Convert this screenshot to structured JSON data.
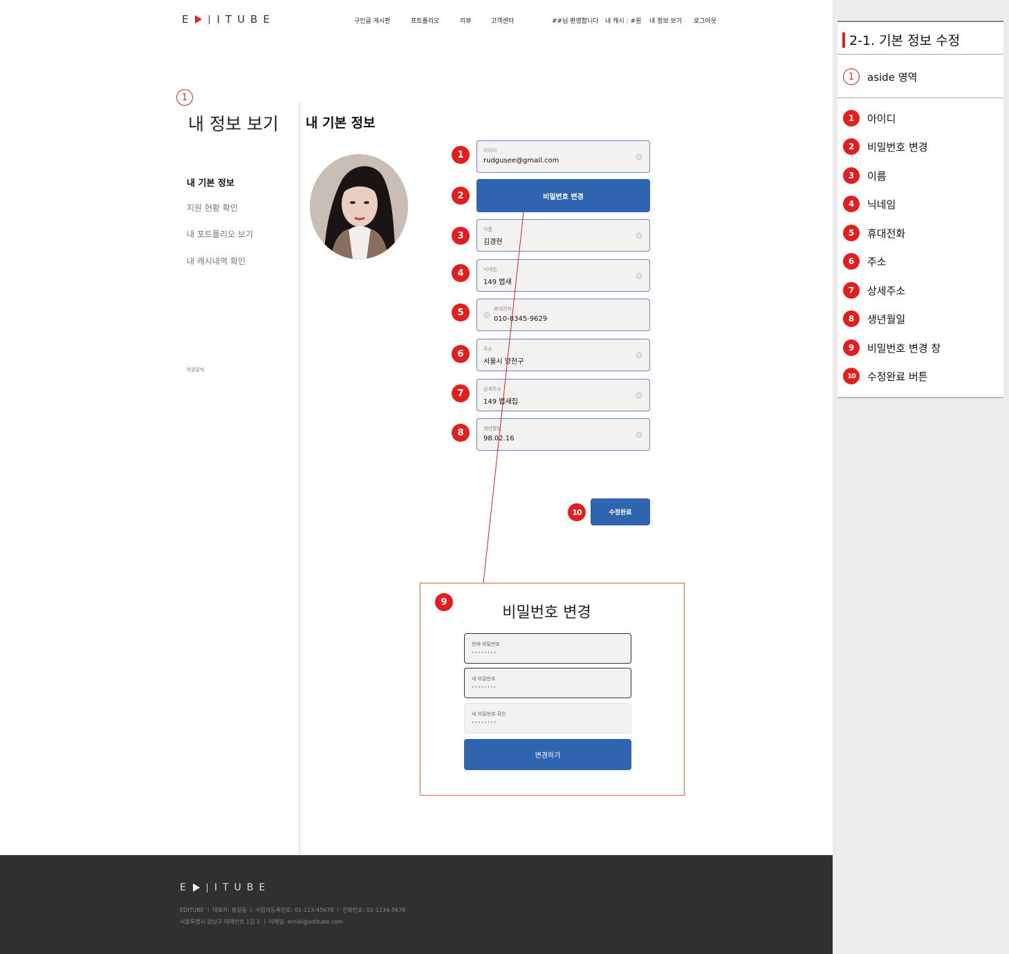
{
  "header": {
    "logo": "ITUBE",
    "logo_prefix": "E",
    "nav": [
      "구인글 게시판",
      "포트폴리오",
      "리뷰",
      "고객센터"
    ],
    "welcome": "##님 환영합니다",
    "cash": "내 캐시 : #원",
    "my_info": "내 정보 보기",
    "logout": "로그아웃"
  },
  "aside": {
    "marker": "1",
    "title": "내 정보 보기",
    "items": [
      "내 기본 정보",
      "지원 현황 확인",
      "내 포트폴리오 보기",
      "내 캐시내역 확인"
    ],
    "withdraw": "회원탈퇴"
  },
  "main": {
    "title": "내 기본 정보",
    "fields": [
      {
        "num": "1",
        "label": "아이디",
        "value": "rudgusee@gmail.com"
      },
      {
        "num": "3",
        "label": "이름",
        "value": "김경현"
      },
      {
        "num": "4",
        "label": "닉네임",
        "value": "149 뱁새"
      },
      {
        "num": "5",
        "label": "휴대전화",
        "value": "010-8345-9629"
      },
      {
        "num": "6",
        "label": "주소",
        "value": "서울시 양천구"
      },
      {
        "num": "7",
        "label": "상세주소",
        "value": "149 뱁새집"
      },
      {
        "num": "8",
        "label": "생년월일",
        "value": "98.02.16"
      }
    ],
    "pw_change": {
      "num": "2",
      "label": "비밀번호 변경"
    },
    "submit": {
      "num": "10",
      "label": "수정완료"
    },
    "clear_icon": "×"
  },
  "modal": {
    "num": "9",
    "title": "비밀번호 변경",
    "fields": [
      {
        "label": "현재 비밀번호",
        "value": "••••••••"
      },
      {
        "label": "새 비밀번호",
        "value": "••••••••"
      },
      {
        "label": "새 비밀번호 확인",
        "value": "••••••••"
      }
    ],
    "submit": "변경하기"
  },
  "footer": {
    "logo_prefix": "E",
    "logo": "ITUBE",
    "line1": "EDITUBE  ㅣ 대표자: 홍길동  ㅣ 사업자등록번호: 01-123-45678    ㅣ 전화번호: 02-1234-5678",
    "line2": "서울특별시 강남구 테헤란로 1길 1  ㅣ 이메일: email@editube.com"
  },
  "annotations": {
    "title": "2-1. 기본 정보 수정",
    "aside_item": {
      "num": "1",
      "label": "aside 영역"
    },
    "items": [
      {
        "num": "1",
        "label": "아이디"
      },
      {
        "num": "2",
        "label": "비밀번호 변경"
      },
      {
        "num": "3",
        "label": "이름"
      },
      {
        "num": "4",
        "label": "닉네임"
      },
      {
        "num": "5",
        "label": "휴대전화"
      },
      {
        "num": "6",
        "label": "주소"
      },
      {
        "num": "7",
        "label": "상세주소"
      },
      {
        "num": "8",
        "label": "생년월일"
      },
      {
        "num": "9",
        "label": "비밀번호 변경 창"
      },
      {
        "num": "10",
        "label": "수정완료 버튼"
      }
    ]
  },
  "colors": {
    "accent_red": "#e41e1e",
    "primary_blue": "#2f64b0",
    "modal_border": "#f0663a",
    "footer_bg": "#303030"
  }
}
